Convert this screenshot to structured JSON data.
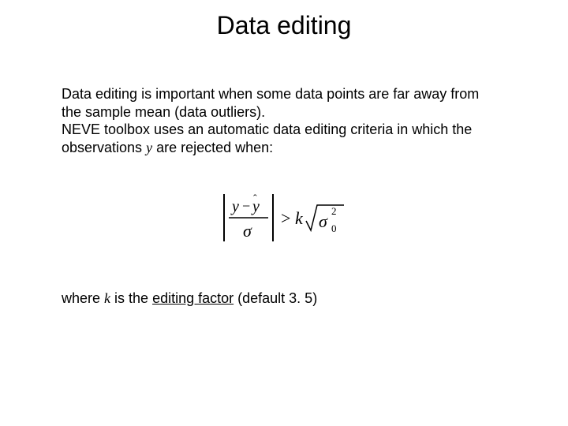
{
  "title": "Data editing",
  "body": {
    "line1": "Data editing is important when some data points are far away from",
    "line2": "the sample mean (data outliers).",
    "line3": "NEVE toolbox uses an automatic data editing criteria in which the",
    "line4a": "observations ",
    "line4_var": "y",
    "line4b": " are rejected when:"
  },
  "footer": {
    "prefix": "where ",
    "var": "k",
    "mid": " is the ",
    "term": "editing factor",
    "suffix": " (default 3. 5)"
  },
  "formula": {
    "numerator_y": "y",
    "numerator_minus": "−",
    "numerator_yhat": "ŷ",
    "denominator": "σ",
    "gt": ">",
    "k": "k",
    "sigma": "σ",
    "zero": "0",
    "two": "2"
  }
}
